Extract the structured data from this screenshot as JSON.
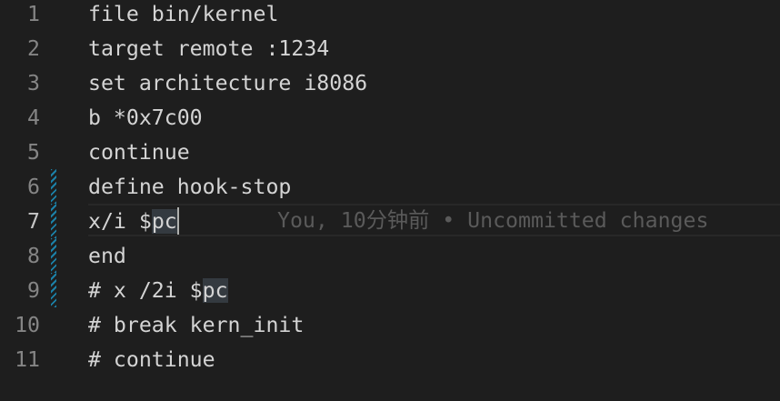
{
  "editor": {
    "lines": [
      {
        "number": "1",
        "text": "file bin/kernel"
      },
      {
        "number": "2",
        "text": "target remote :1234"
      },
      {
        "number": "3",
        "text": "set architecture i8086"
      },
      {
        "number": "4",
        "text": "b *0x7c00"
      },
      {
        "number": "5",
        "text": "continue"
      },
      {
        "number": "6",
        "text": "define hook-stop"
      },
      {
        "number": "7",
        "prefix": "x/i $",
        "highlight": "pc"
      },
      {
        "number": "8",
        "text": "end"
      },
      {
        "number": "9",
        "prefix": "# x /2i $",
        "highlight": "pc"
      },
      {
        "number": "10",
        "text": "# break kern_init"
      },
      {
        "number": "11",
        "text": "# continue"
      }
    ],
    "active_line": 7,
    "modified_lines": [
      6,
      7,
      8,
      9
    ],
    "blame_annotation": "You, 10分钟前 • Uncommitted changes"
  },
  "colors": {
    "background": "#1e1e1e",
    "text": "#d4d4d4",
    "line_number": "#858585",
    "active_line_number": "#c6c6c6",
    "modified_gutter": "#1b81a8",
    "blame_text": "#5a5a5a",
    "word_highlight": "#343a40"
  }
}
